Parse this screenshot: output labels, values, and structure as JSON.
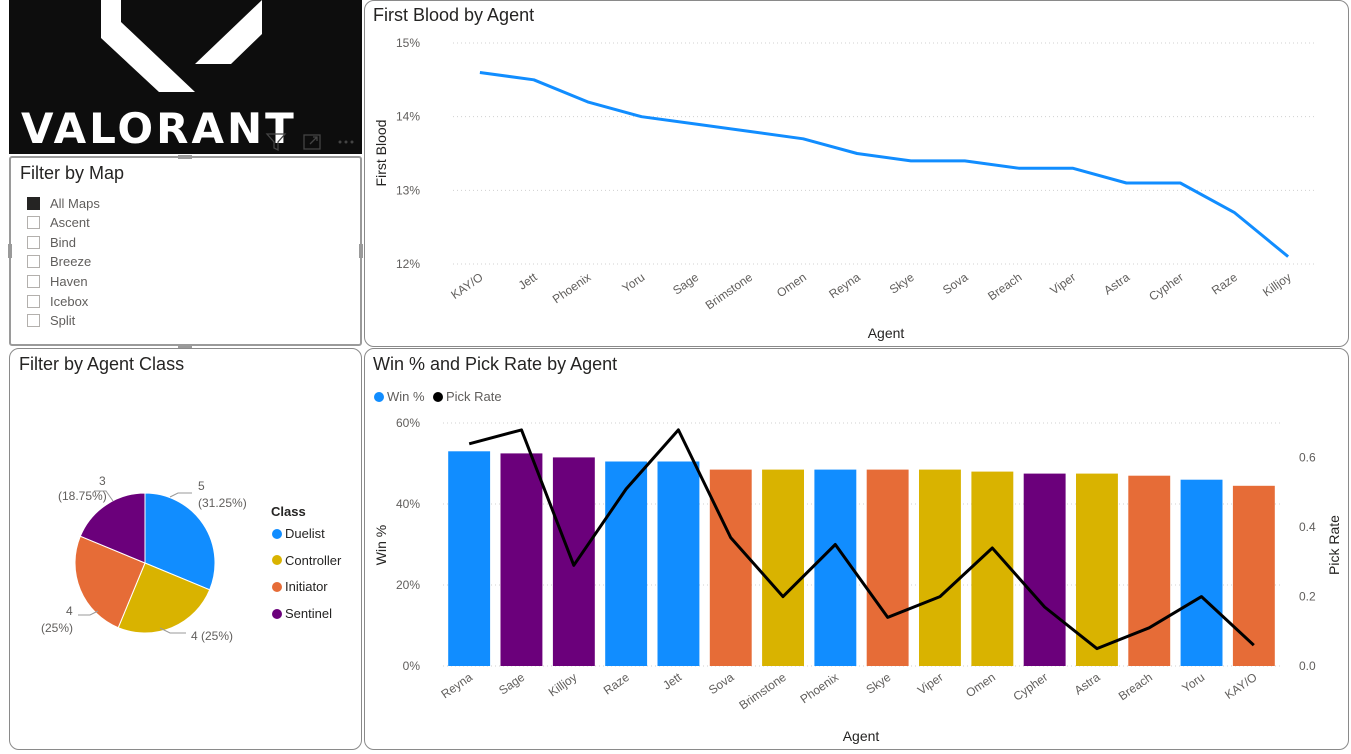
{
  "logo": {
    "text": "VALORANT"
  },
  "map_filter": {
    "title": "Filter by Map",
    "items": [
      {
        "label": "All Maps",
        "checked": true
      },
      {
        "label": "Ascent",
        "checked": false
      },
      {
        "label": "Bind",
        "checked": false
      },
      {
        "label": "Breeze",
        "checked": false
      },
      {
        "label": "Haven",
        "checked": false
      },
      {
        "label": "Icebox",
        "checked": false
      },
      {
        "label": "Split",
        "checked": false
      }
    ]
  },
  "visual_toolbar": {
    "icons": [
      "filter-icon",
      "focus-mode-icon",
      "more-options-icon"
    ]
  },
  "class_filter": {
    "title": "Filter by Agent Class",
    "legend_title": "Class"
  },
  "chart_data": [
    {
      "id": "first_blood",
      "type": "line",
      "title": "First Blood by Agent",
      "xlabel": "Agent",
      "ylabel": "First Blood",
      "categories": [
        "KAY/O",
        "Jett",
        "Phoenix",
        "Yoru",
        "Sage",
        "Brimstone",
        "Omen",
        "Reyna",
        "Skye",
        "Sova",
        "Breach",
        "Viper",
        "Astra",
        "Cypher",
        "Raze",
        "Killjoy"
      ],
      "values": [
        14.6,
        14.5,
        14.2,
        14.0,
        13.9,
        13.8,
        13.7,
        13.5,
        13.4,
        13.4,
        13.3,
        13.3,
        13.1,
        13.1,
        12.7,
        12.1
      ],
      "y_ticks": [
        "15%",
        "14%",
        "13%",
        "12%"
      ],
      "ylim": [
        12,
        15
      ],
      "color": "#118DFF",
      "grid": true
    },
    {
      "id": "agent_class",
      "type": "pie",
      "title": "Filter by Agent Class",
      "legend_title": "Class",
      "slices": [
        {
          "label": "Duelist",
          "value": 5,
          "pct": "31.25%",
          "color": "#118DFF"
        },
        {
          "label": "Controller",
          "value": 4,
          "pct": "25%",
          "color": "#D9B300"
        },
        {
          "label": "Initiator",
          "value": 4,
          "pct": "25%",
          "color": "#E66C37"
        },
        {
          "label": "Sentinel",
          "value": 3,
          "pct": "18.75%",
          "color": "#6B007B"
        }
      ],
      "data_labels": [
        {
          "value": "5",
          "pct": "(31.25%)"
        },
        {
          "value": "4 (25%)"
        },
        {
          "value": "4",
          "pct": "(25%)"
        },
        {
          "value": "3",
          "pct": "(18.75%)"
        }
      ],
      "legend_position": "right"
    },
    {
      "id": "win_pick",
      "type": "bar",
      "title": "Win % and Pick Rate by Agent",
      "xlabel": "Agent",
      "ylabel": "Win %",
      "y2label": "Pick Rate",
      "legend": [
        {
          "name": "Win %",
          "color": "#118DFF"
        },
        {
          "name": "Pick Rate",
          "color": "#000000"
        }
      ],
      "legend_position": "top-left",
      "categories": [
        "Reyna",
        "Sage",
        "Killjoy",
        "Raze",
        "Jett",
        "Sova",
        "Brimstone",
        "Phoenix",
        "Skye",
        "Viper",
        "Omen",
        "Cypher",
        "Astra",
        "Breach",
        "Yoru",
        "KAY/O"
      ],
      "win_pct": [
        53,
        52.5,
        51.5,
        50.5,
        50.5,
        48.5,
        48.5,
        48.5,
        48.5,
        48.5,
        48,
        47.5,
        47.5,
        47,
        46,
        44.5
      ],
      "bar_colors": [
        "#118DFF",
        "#6B007B",
        "#6B007B",
        "#118DFF",
        "#118DFF",
        "#E66C37",
        "#D9B300",
        "#118DFF",
        "#E66C37",
        "#D9B300",
        "#D9B300",
        "#6B007B",
        "#D9B300",
        "#E66C37",
        "#118DFF",
        "#E66C37"
      ],
      "pick_rate": [
        0.64,
        0.68,
        0.29,
        0.51,
        0.68,
        0.37,
        0.2,
        0.35,
        0.14,
        0.2,
        0.34,
        0.17,
        0.05,
        0.11,
        0.2,
        0.06
      ],
      "y_ticks": [
        "60%",
        "40%",
        "20%",
        "0%"
      ],
      "ylim": [
        0,
        60
      ],
      "y2_ticks": [
        "0.6",
        "0.4",
        "0.2",
        "0.0"
      ],
      "y2lim": [
        0,
        0.7
      ],
      "grid": true
    }
  ]
}
